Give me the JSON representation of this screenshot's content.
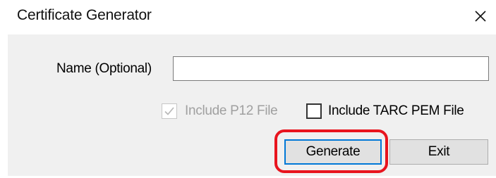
{
  "window": {
    "title": "Certificate Generator",
    "close_icon": "close-icon"
  },
  "form": {
    "name_label": "Name (Optional)",
    "name_value": "",
    "name_placeholder": ""
  },
  "options": {
    "p12": {
      "label": "Include P12 File",
      "checked": true,
      "enabled": false
    },
    "pem": {
      "label": "Include TARC PEM File",
      "checked": false,
      "enabled": true
    }
  },
  "buttons": {
    "generate_label": "Generate",
    "exit_label": "Exit"
  },
  "colors": {
    "client_background": "#f0f0f0",
    "focus_border": "#0078d7",
    "highlight_annotation": "#e8141e",
    "disabled_text": "#a0a0a0"
  }
}
